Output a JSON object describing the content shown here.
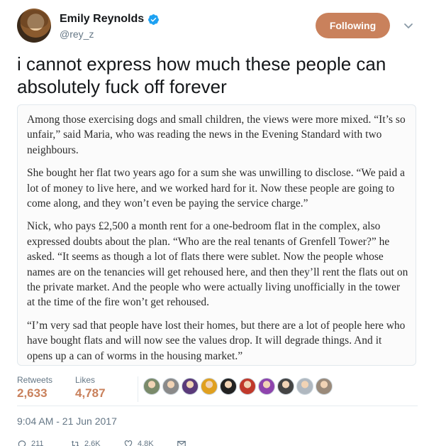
{
  "user": {
    "display_name": "Emily Reynolds",
    "handle": "@rey_z",
    "verified": true,
    "avatar_icon": "profile-photo"
  },
  "follow_button": {
    "label": "Following",
    "color": "#c9815c"
  },
  "tweet": {
    "text": "i cannot express how much these people can absolutely fuck off forever"
  },
  "media": {
    "paragraphs": [
      "Among those exercising dogs and small children, the views were more mixed. “It’s so unfair,” said Maria, who was reading the news in the Evening Standard with two neighbours.",
      "She bought her flat two years ago for a sum she was unwilling to disclose. “We paid a lot of money to live here, and we worked hard for it. Now these people are going to come along, and they won’t even be paying the service charge.”",
      "Nick, who pays £2,500 a month rent for a one-bedroom flat in the complex, also expressed doubts about the plan. “Who are the real tenants of Grenfell Tower?” he asked. “It seems as though a lot of flats there were sublet. Now the people whose names are on the tenancies will get rehoused here, and then they’ll rent the flats out on the private market. And the people who were actually living unofficially in the tower at the time of the fire won’t get rehoused.",
      "“I’m very sad that people have lost their homes, but there are a lot of people here who have bought flats and will now see the values drop. It will degrade things. And it opens up a can of worms in the housing market.”"
    ]
  },
  "stats": {
    "retweets_label": "Retweets",
    "retweets_value": "2,633",
    "likes_label": "Likes",
    "likes_value": "4,787"
  },
  "likers": [
    {
      "icon": "liker-avatar-1",
      "color": "#7a8a6a"
    },
    {
      "icon": "liker-avatar-2",
      "color": "#8a8a8a"
    },
    {
      "icon": "liker-avatar-3",
      "color": "#5a3a7a"
    },
    {
      "icon": "liker-avatar-4",
      "color": "#e0a020"
    },
    {
      "icon": "liker-avatar-5",
      "color": "#222222"
    },
    {
      "icon": "liker-avatar-6",
      "color": "#c0392b"
    },
    {
      "icon": "liker-avatar-7",
      "color": "#8e44ad"
    },
    {
      "icon": "liker-avatar-8",
      "color": "#444444"
    },
    {
      "icon": "liker-avatar-9",
      "color": "#b0b8c0"
    },
    {
      "icon": "liker-avatar-10",
      "color": "#9a8a7a"
    }
  ],
  "timestamp": "9:04 AM - 21 Jun 2017",
  "actions": {
    "reply_count": "211",
    "retweet_count": "2.6K",
    "like_count": "4.8K"
  }
}
